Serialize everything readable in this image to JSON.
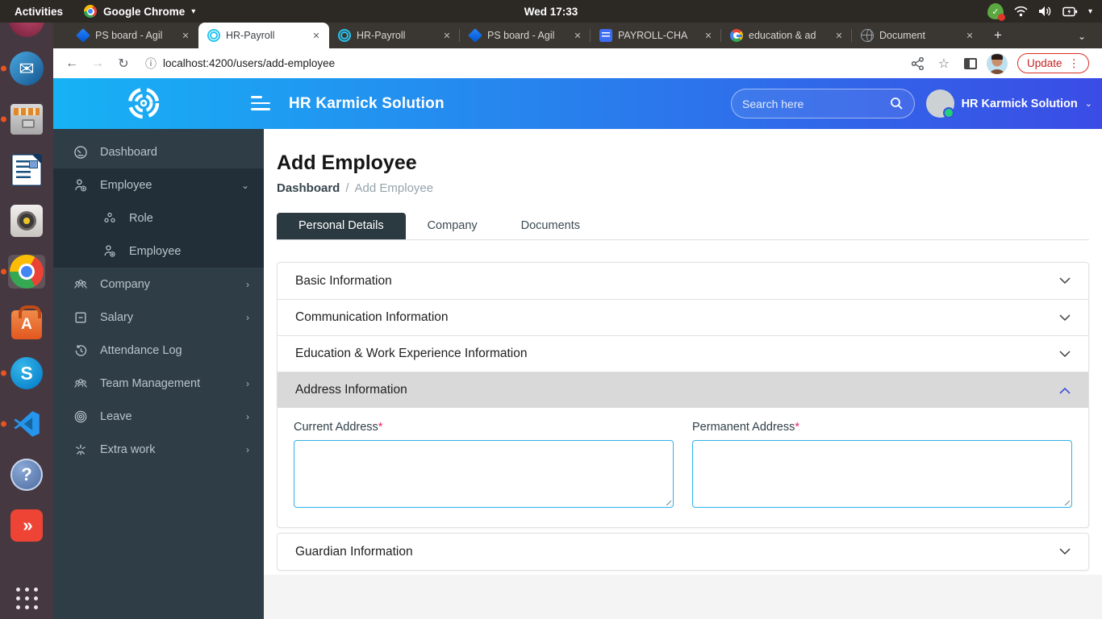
{
  "desktop": {
    "topbar": {
      "activities": "Activities",
      "app_menu": "Google Chrome",
      "clock": "Wed 17:33"
    }
  },
  "browser": {
    "tabs": [
      {
        "title": "PS board - Agil"
      },
      {
        "title": "HR-Payroll"
      },
      {
        "title": "HR-Payroll"
      },
      {
        "title": "PS board - Agil"
      },
      {
        "title": "PAYROLL-CHA"
      },
      {
        "title": "education & ad"
      },
      {
        "title": "Document"
      }
    ],
    "toolbar": {
      "url": "localhost:4200/users/add-employee",
      "update_label": "Update"
    }
  },
  "app": {
    "header": {
      "title": "HR Karmick Solution",
      "search_placeholder": "Search here",
      "user_name": "HR Karmick Solution"
    },
    "sidebar": {
      "dashboard": "Dashboard",
      "employee": "Employee",
      "role": "Role",
      "employee_sub": "Employee",
      "company": "Company",
      "salary": "Salary",
      "attendance": "Attendance Log",
      "team": "Team Management",
      "leave": "Leave",
      "extra": "Extra work"
    },
    "main": {
      "title": "Add Employee",
      "breadcrumb_root": "Dashboard",
      "breadcrumb_sep": "/",
      "breadcrumb_current": "Add Employee",
      "tab_personal": "Personal Details",
      "tab_company": "Company",
      "tab_documents": "Documents",
      "acc_basic": "Basic Information",
      "acc_comm": "Communication Information",
      "acc_edu": "Education & Work Experience Information",
      "acc_addr": "Address Information",
      "acc_guardian": "Guardian Information",
      "label_current": "Current Address",
      "label_permanent": "Permanent Address",
      "required": "*"
    }
  },
  "icons": {
    "close": "✕",
    "plus": "+",
    "caret": "▾",
    "chevron_down": "⌄",
    "chevron_right": "›",
    "dots": "⋮",
    "star": "☆",
    "back": "←",
    "forward": "→",
    "reload": "↻",
    "info": "ⓘ",
    "check": "✓",
    "question": "?",
    "skype_s": "S",
    "software_a": "A",
    "anydesk": "»",
    "chevron_up": "∧",
    "chevron_down_acc": "∨"
  },
  "colors": {
    "header_gradient_start": "#17b2f5",
    "header_gradient_end": "#3a4ce5",
    "sidebar_bg": "#2f3d46",
    "active_tab_bg": "#2b3940",
    "expanded_accordion_bg": "#d9d9d9",
    "textarea_border": "#2fb1ea",
    "required_mark": "#ec2262",
    "update_red": "#c5221f"
  }
}
